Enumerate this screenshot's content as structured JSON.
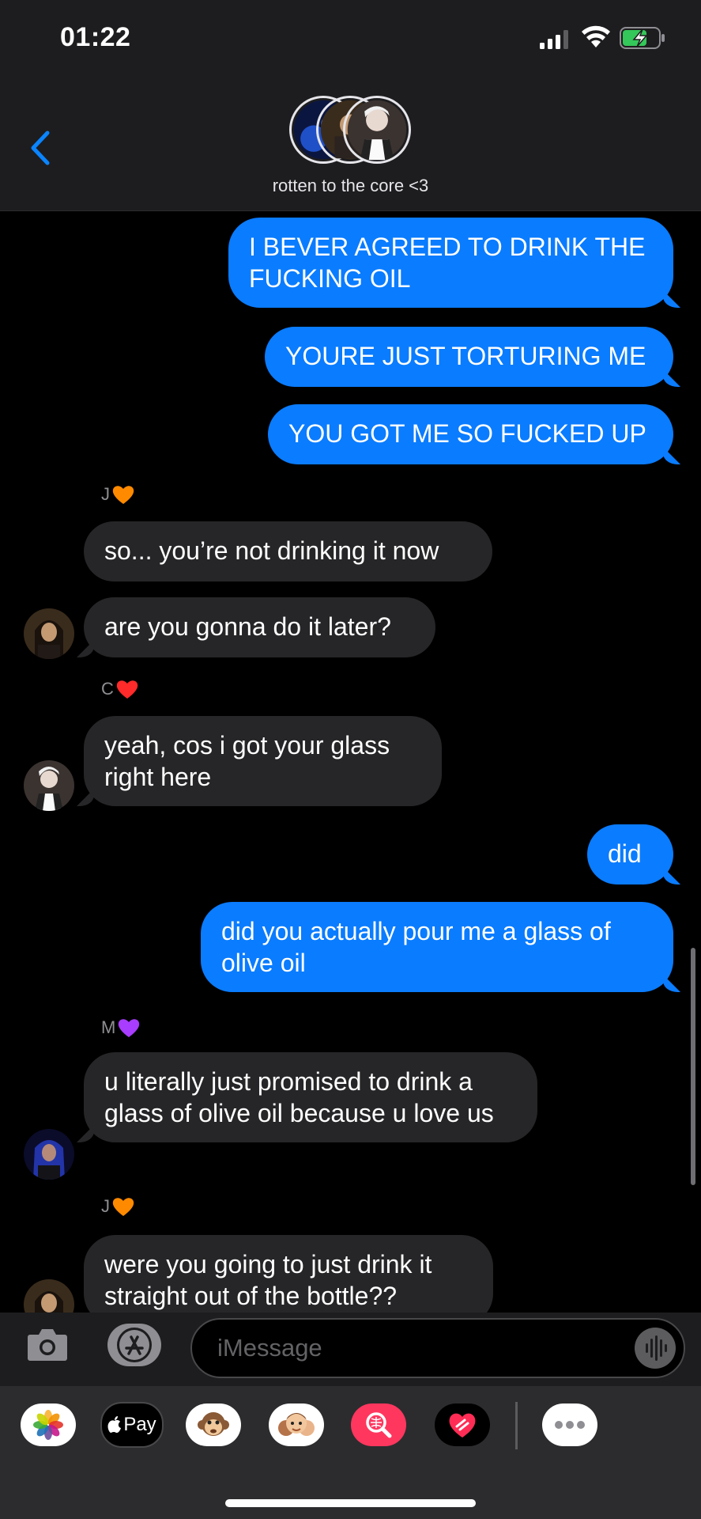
{
  "status_bar": {
    "time": "01:22"
  },
  "header": {
    "group_name": "rotten to the core <3"
  },
  "messages": [
    {
      "text": "I BEVER AGREED TO DRINK THE FUCKING OIL"
    },
    {
      "text": "YOURE JUST TORTURING ME"
    },
    {
      "text": "YOU GOT ME SO FUCKED UP"
    },
    {
      "text": "so... you’re not drinking it now"
    },
    {
      "text": "are you gonna do it later?"
    },
    {
      "text": "yeah, cos i got your glass right here"
    },
    {
      "text": "did"
    },
    {
      "text": "did you actually pour me a glass of olive oil"
    },
    {
      "text": "u literally just promised to drink a glass of olive oil because u love us"
    },
    {
      "text": "were you going to just drink it straight out of the bottle??"
    }
  ],
  "senders": [
    "J",
    "C",
    "M",
    "J"
  ],
  "sender_hearts": [
    "#ff8a00",
    "#ff2a2a",
    "#a83cff",
    "#ff8a00"
  ],
  "composer": {
    "placeholder": "iMessage"
  },
  "app_drawer": {
    "apple_pay_label": "Pay",
    "icons": [
      "photos-icon",
      "apple-pay-icon",
      "animoji-icon",
      "memoji-icon",
      "image-search-icon",
      "digital-touch-icon",
      "more-icon"
    ]
  },
  "colors": {
    "outgoing": "#0a7cff",
    "incoming": "#262628",
    "accent": "#0a84ff"
  }
}
